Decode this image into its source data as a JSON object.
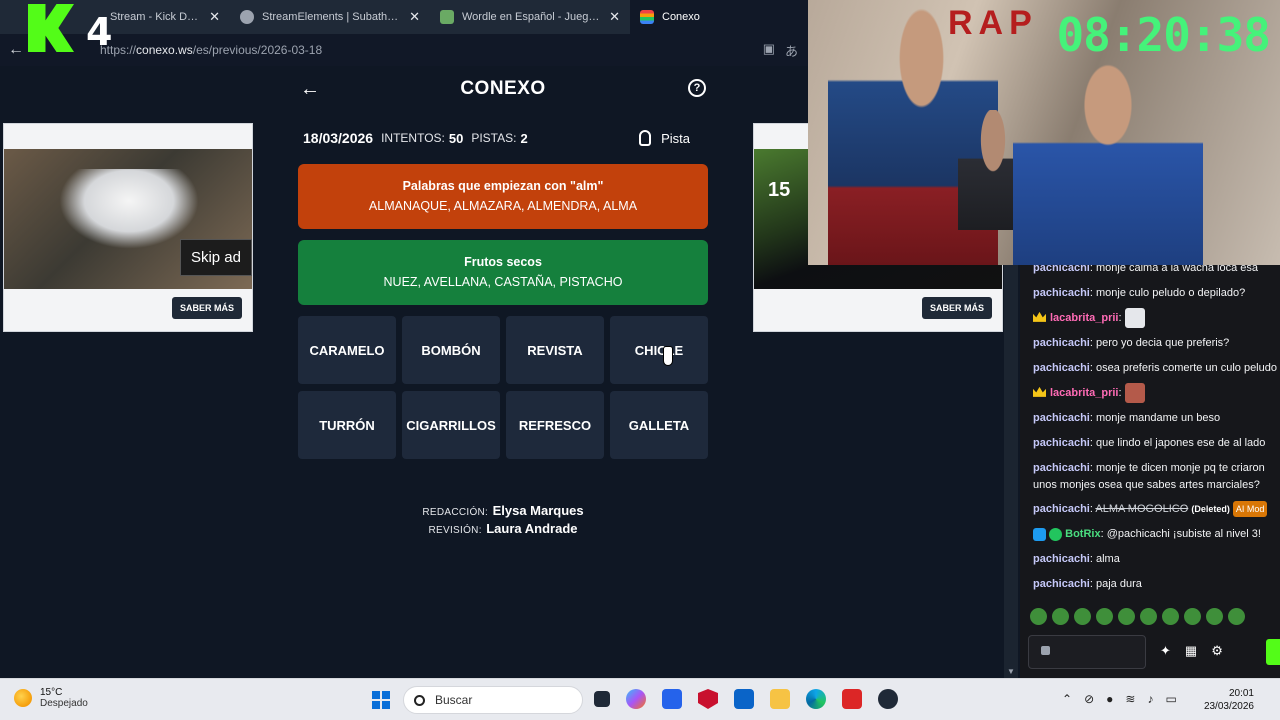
{
  "browser": {
    "tabs": [
      {
        "label": "Stream - Kick Dashboard",
        "icon_color": "#53fc18",
        "active": false
      },
      {
        "label": "StreamElements | Subathon Count",
        "icon_color": "#9ca3af",
        "active": false
      },
      {
        "label": "Wordle en Español - Juego Diario",
        "icon_color": "#6aaa64",
        "active": false
      },
      {
        "label": "Conexo",
        "icon_color": "#a855f7",
        "active": true
      }
    ],
    "url_prefix": "https://",
    "url_host": "conexo.ws",
    "url_path": "/es/previous/2026-03-18"
  },
  "overlay": {
    "kick_number": "4",
    "timer": "08:20:38",
    "graffiti": "RAP"
  },
  "ads": {
    "left": {
      "skip_label": "Skip ad",
      "cta": "SABER MÁS"
    },
    "right": {
      "brand": "15",
      "cta": "SABER MÁS"
    }
  },
  "game": {
    "title": "CONEXO",
    "date": "18/03/2026",
    "attempts_label": "INTENTOS:",
    "attempts": "50",
    "hints_label": "PISTAS:",
    "hints": "2",
    "hint_button": "Pista",
    "solved": [
      {
        "title": "Palabras que empiezan con \"alm\"",
        "words": "ALMANAQUE, ALMAZARA, ALMENDRA, ALMA",
        "color": "#c2410c"
      },
      {
        "title": "Frutos secos",
        "words": "NUEZ, AVELLANA, CASTAÑA, PISTACHO",
        "color": "#15803d"
      }
    ],
    "tiles": [
      "CARAMELO",
      "BOMBÓN",
      "REVISTA",
      "CHICLE",
      "TURRÓN",
      "CIGARRILLOS",
      "REFRESCO",
      "GALLETA"
    ],
    "credits": {
      "redaccion_label": "REDACCIÓN:",
      "redaccion": "Elysa Marques",
      "revision_label": "REVISIÓN:",
      "revision": "Laura Andrade"
    }
  },
  "chat": {
    "messages": [
      {
        "user": "pachicachi",
        "text": "monje calma a la wacha loca esa"
      },
      {
        "user": "pachicachi",
        "text": "monje culo peludo o depilado?"
      },
      {
        "user": "lacabrita_prii",
        "text": ""
      },
      {
        "user": "pachicachi",
        "text": "pero yo decia que preferis?"
      },
      {
        "user": "pachicachi",
        "text": "osea preferis comerte un culo peludo"
      },
      {
        "user": "lacabrita_prii",
        "text": ""
      },
      {
        "user": "pachicachi",
        "text": "monje mandame un beso"
      },
      {
        "user": "pachicachi",
        "text": "que lindo el japones ese de al lado"
      },
      {
        "user": "pachicachi",
        "text": "monje te dicen monje pq te criaron"
      },
      {
        "user": "",
        "text": "unos monjes osea que sabes artes marciales?"
      },
      {
        "user": "pachicachi",
        "text": "ALMA MOGOLICO",
        "deleted": "(Deleted)",
        "mod": "AI Mod"
      },
      {
        "user": "BotRix",
        "text": "@pachicachi ¡subiste al nivel 3!"
      },
      {
        "user": "pachicachi",
        "text": "alma"
      },
      {
        "user": "pachicachi",
        "text": "paja dura"
      }
    ]
  },
  "taskbar": {
    "temp": "15°C",
    "weather": "Despejado",
    "search_placeholder": "Buscar",
    "time": "20:01",
    "date": "23/03/2026"
  }
}
